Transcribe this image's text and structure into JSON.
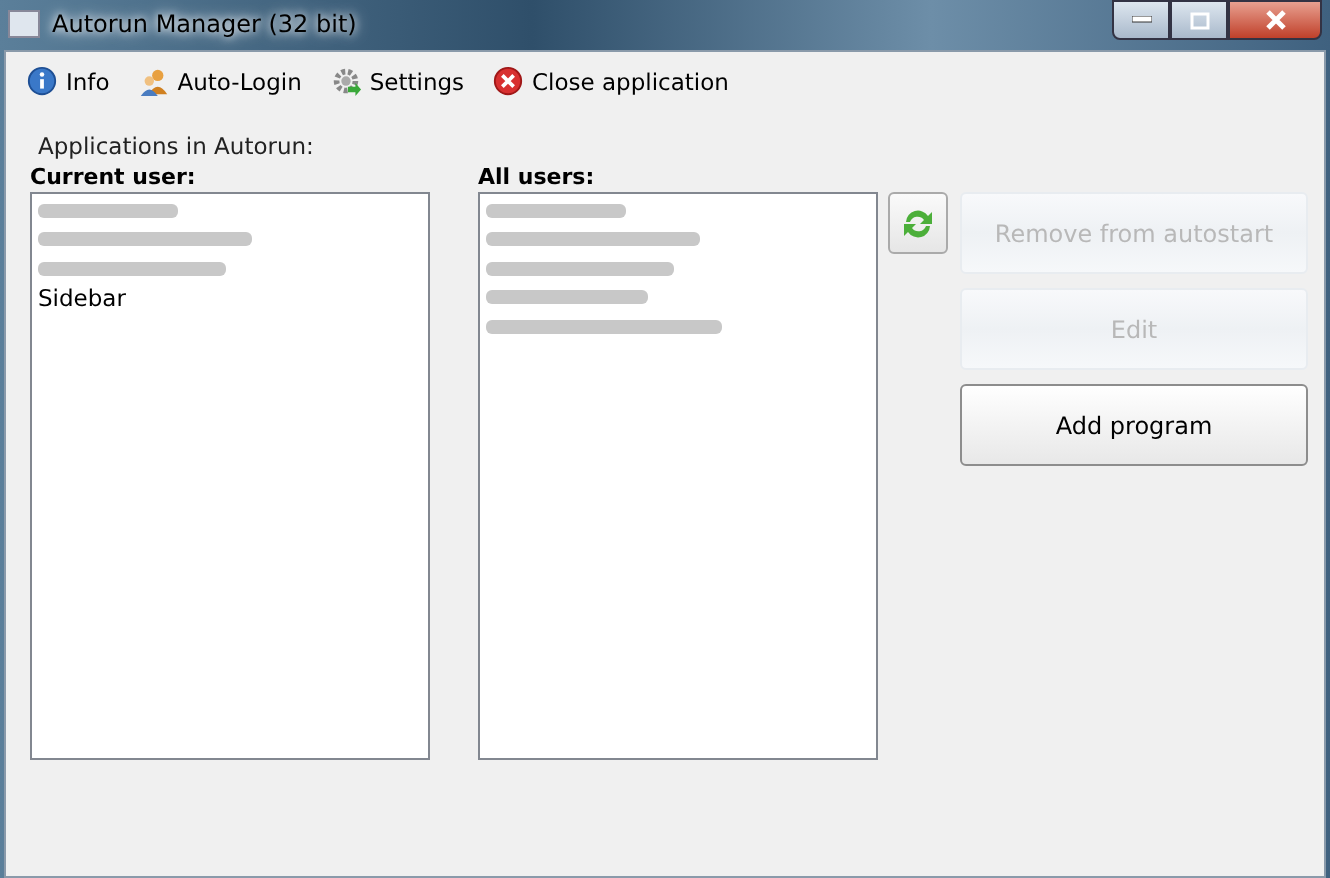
{
  "window": {
    "title": "Autorun Manager (32 bit)"
  },
  "toolbar": [
    {
      "kind": "info",
      "label": "Info"
    },
    {
      "kind": "users",
      "label": "Auto-Login"
    },
    {
      "kind": "gear",
      "label": "Settings"
    },
    {
      "kind": "close",
      "label": "Close application"
    }
  ],
  "section_title": "Applications in Autorun:",
  "current_user": {
    "label": "Current user:",
    "items": [
      {
        "kind": "redacted"
      },
      {
        "kind": "redacted"
      },
      {
        "kind": "redacted"
      },
      {
        "kind": "text",
        "name": "Sidebar"
      }
    ]
  },
  "all_users": {
    "label": "All users:",
    "items": [
      {
        "kind": "redacted"
      },
      {
        "kind": "redacted"
      },
      {
        "kind": "redacted"
      },
      {
        "kind": "redacted"
      },
      {
        "kind": "redacted"
      }
    ]
  },
  "buttons": [
    {
      "label": "Remove from autostart",
      "disabled": true
    },
    {
      "label": "Edit",
      "disabled": true
    },
    {
      "label": "Add program",
      "disabled": false
    }
  ]
}
